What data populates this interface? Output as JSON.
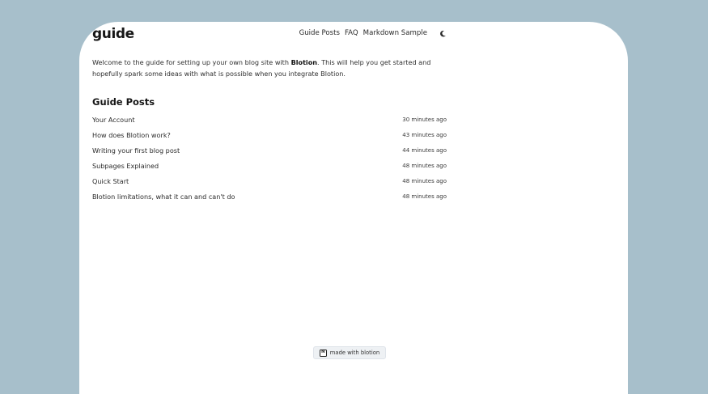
{
  "site": {
    "logo": "guide"
  },
  "nav": {
    "items": [
      {
        "label": "Guide Posts"
      },
      {
        "label": "FAQ"
      },
      {
        "label": "Markdown Sample"
      }
    ],
    "theme_toggle_icon": "moon-icon"
  },
  "intro": {
    "part1": "Welcome to the guide for setting up your own blog site with ",
    "brand": "Blotion",
    "part2": ". This will help you get started and hopefully spark some ideas with what is possible when you integrate Blotion."
  },
  "section": {
    "title": "Guide Posts"
  },
  "posts": [
    {
      "title": "Your Account",
      "time": "30 minutes ago"
    },
    {
      "title": "How does Blotion work?",
      "time": "43 minutes ago"
    },
    {
      "title": "Writing your first blog post",
      "time": "44 minutes ago"
    },
    {
      "title": "Subpages Explained",
      "time": "48 minutes ago"
    },
    {
      "title": "Quick Start",
      "time": "48 minutes ago"
    },
    {
      "title": "Blotion limitations, what it can and can't do",
      "time": "48 minutes ago"
    }
  ],
  "footer": {
    "badge_label": "made with blotion",
    "badge_icon": "notion-icon",
    "badge_icon_glyph": "N"
  },
  "colors": {
    "page_background": "#a7bfcb",
    "card_background": "#ffffff",
    "badge_background": "#eef1f4"
  }
}
